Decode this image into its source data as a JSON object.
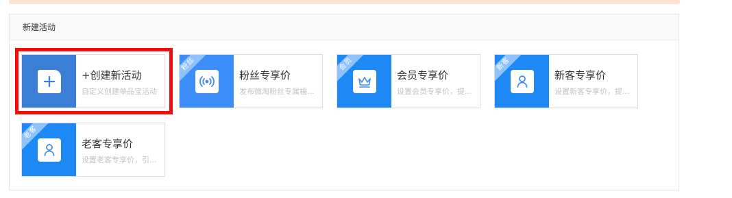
{
  "panel": {
    "title": "新建活动"
  },
  "cards": [
    {
      "title": "+创建新活动",
      "desc": "自定义创建单品宝活动",
      "icon": "plus-document-icon",
      "badge": ""
    },
    {
      "title": "粉丝专享价",
      "desc": "发布微淘粉丝专属福...",
      "icon": "broadcast-icon",
      "badge": "粉丝"
    },
    {
      "title": "会员专享价",
      "desc": "设置会员专享价，提...",
      "icon": "crown-icon",
      "badge": "会员"
    },
    {
      "title": "新客专享价",
      "desc": "设置新客专享价，提...",
      "icon": "user-icon",
      "badge": "新客"
    },
    {
      "title": "老客专享价",
      "desc": "设置老客专享价，引...",
      "icon": "user-icon",
      "badge": "老客"
    }
  ],
  "colors": {
    "create_bg": "#3a7fd5",
    "card_bg": "#1e88f5",
    "fans_bg": "#3d8ef8",
    "icon_blue": "#3b8cf2",
    "ribbon_bg": "#8fc3ff",
    "highlight": "#f20d0d"
  }
}
